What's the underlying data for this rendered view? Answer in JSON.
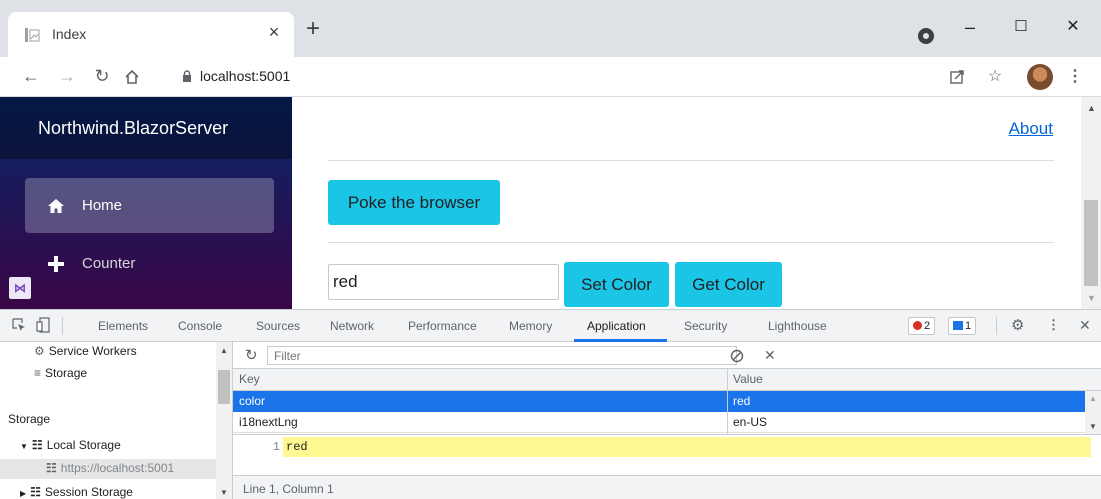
{
  "browser": {
    "tab_title": "Index",
    "tab_close": "×",
    "new_tab": "+",
    "url": "localhost:5001",
    "window_controls": {
      "minimize": "–",
      "maximize": "☐",
      "close": "✕"
    }
  },
  "app": {
    "brand": "Northwind.BlazorServer",
    "nav": [
      {
        "label": "Home",
        "icon": "home-icon",
        "active": true
      },
      {
        "label": "Counter",
        "icon": "plus-icon",
        "active": false
      }
    ],
    "about_link": "About",
    "poke_button": "Poke the browser",
    "color_input_value": "red",
    "set_color_button": "Set Color",
    "get_color_button": "Get Color",
    "accent_color": "#1bc5e5"
  },
  "devtools": {
    "tabs": [
      "Elements",
      "Console",
      "Sources",
      "Network",
      "Performance",
      "Memory",
      "Application",
      "Security",
      "Lighthouse"
    ],
    "active_tab": "Application",
    "error_count": "2",
    "message_count": "1",
    "sidebar": {
      "service_workers": "Service Workers",
      "storage_item": "Storage",
      "storage_section": "Storage",
      "local_storage": "Local Storage",
      "local_storage_origin": "https://localhost:5001",
      "session_storage": "Session Storage"
    },
    "filter_placeholder": "Filter",
    "columns": {
      "key": "Key",
      "value": "Value"
    },
    "rows": [
      {
        "key": "color",
        "value": "red",
        "selected": true
      },
      {
        "key": "i18nextLng",
        "value": "en-US",
        "selected": false
      }
    ],
    "preview": {
      "line_number": "1",
      "content": "red"
    },
    "status": "Line 1, Column 1"
  }
}
